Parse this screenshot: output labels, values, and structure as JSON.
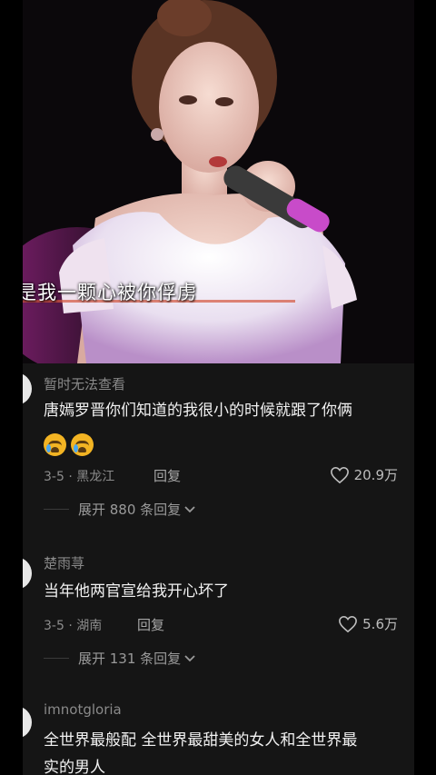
{
  "video": {
    "subtitle": "是我一颗心被你俘虏"
  },
  "comments": [
    {
      "username": "暂时无法查看",
      "text": "唐嫣罗晋你们知道的我很小的时候就跟了你俩",
      "emoji": [
        "crying-face",
        "crying-face"
      ],
      "date": "3-5",
      "location": "黑龙江",
      "reply_label": "回复",
      "likes": "20.9万",
      "expand_label": "展开 880 条回复"
    },
    {
      "username": "楚雨荨",
      "text": "当年他两官宣给我开心坏了",
      "date": "3-5",
      "location": "湖南",
      "reply_label": "回复",
      "likes": "5.6万",
      "expand_label": "展开 131 条回复"
    },
    {
      "username": "imnotgloria",
      "text_line1": "全世界最般配 全世界最甜美的女人和全世界最",
      "text_line2": "实的男人"
    }
  ],
  "colors": {
    "background": "#151515",
    "text": "#f1f1f1",
    "muted": "#8c8c8c"
  }
}
